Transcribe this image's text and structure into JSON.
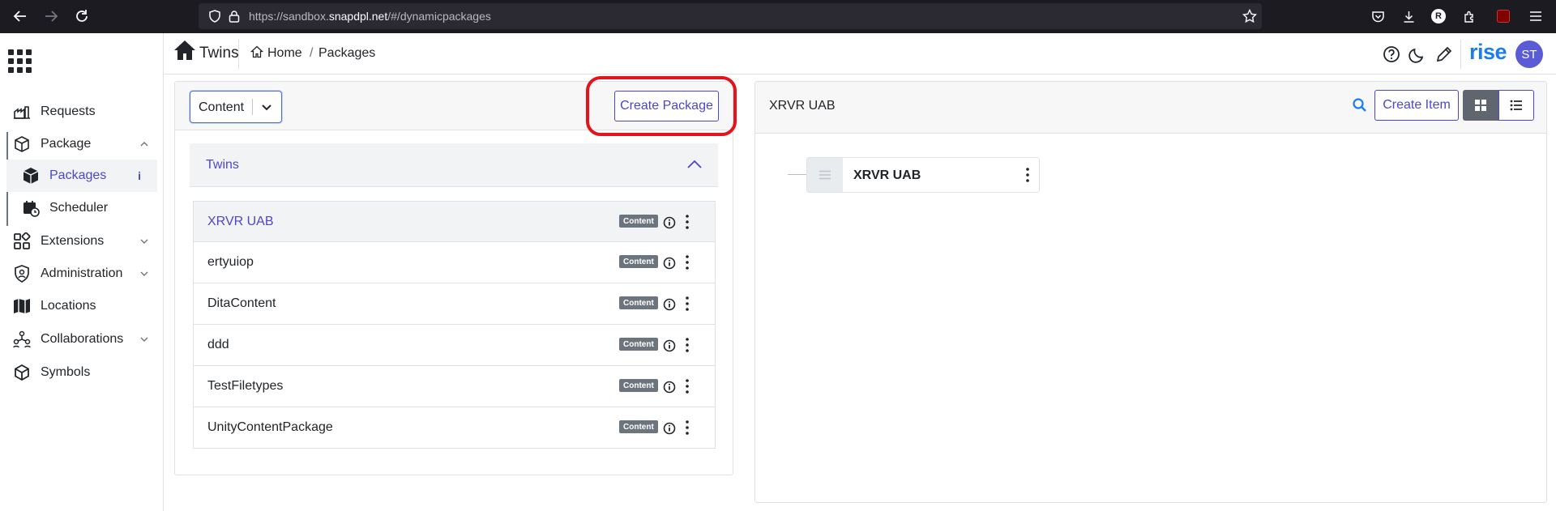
{
  "browser": {
    "url_prefix": "https://sandbox.",
    "url_domain": "snapdpl.net",
    "url_suffix": "/#/dynamicpackages",
    "profile_letter": "R"
  },
  "sidebar": {
    "items": [
      {
        "label": "Requests",
        "icon": "requests-icon"
      },
      {
        "label": "Package",
        "icon": "package-icon",
        "expanded": true
      },
      {
        "label": "Packages",
        "icon": "packages-box-icon",
        "active": true
      },
      {
        "label": "Scheduler",
        "icon": "scheduler-calendar-icon"
      },
      {
        "label": "Extensions",
        "icon": "extensions-icon"
      },
      {
        "label": "Administration",
        "icon": "administration-shield-icon"
      },
      {
        "label": "Locations",
        "icon": "locations-map-icon"
      },
      {
        "label": "Collaborations",
        "icon": "collaborations-icon"
      },
      {
        "label": "Symbols",
        "icon": "symbols-cube-icon"
      }
    ],
    "packages_info": "i"
  },
  "header": {
    "app_title": "Twins",
    "breadcrumb_home": "Home",
    "breadcrumb_sep": "/",
    "breadcrumb_current": "Packages",
    "logo_text": "rise",
    "avatar_initials": "ST"
  },
  "left_panel": {
    "filter_value": "Content",
    "create_button": "Create Package",
    "group_title": "Twins",
    "packages": [
      {
        "name": "XRVR UAB",
        "badge": "Content",
        "selected": true
      },
      {
        "name": "ertyuiop",
        "badge": "Content"
      },
      {
        "name": "DitaContent",
        "badge": "Content"
      },
      {
        "name": "ddd",
        "badge": "Content"
      },
      {
        "name": "TestFiletypes",
        "badge": "Content"
      },
      {
        "name": "UnityContentPackage",
        "badge": "Content"
      }
    ]
  },
  "right_panel": {
    "title": "XRVR UAB",
    "create_button": "Create Item",
    "view_mode": "grid",
    "root_node": "XRVR UAB"
  },
  "colors": {
    "accent": "#4b47c8",
    "highlight": "#e3141b",
    "badge": "#6c757d",
    "logo": "#1b7cf0"
  }
}
